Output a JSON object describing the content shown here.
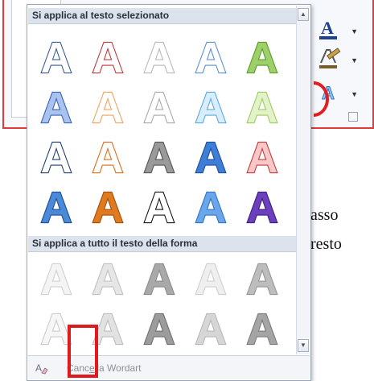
{
  "gallery": {
    "section1_title": "Si applica al testo selezionato",
    "section2_title": "Si applica a tutto il testo della forma",
    "letter": "A",
    "footer_label": "Cancella Wordart",
    "footer_label_prefix": "Canc",
    "footer_label_mnemonic": "e",
    "footer_label_suffix": "lla Wordart",
    "footer_icon": "clear-format-icon"
  },
  "document": {
    "line1": "asso",
    "line2": "resto"
  },
  "ribbon": {
    "tools": [
      {
        "name": "text-fill-icon",
        "letter": "A",
        "accent": "#1f3f8f"
      },
      {
        "name": "text-outline-icon",
        "accent": "#7a5c2c"
      },
      {
        "name": "text-effects-icon",
        "letter": "A",
        "accent": "#2f6fd0"
      }
    ]
  },
  "styles_selected_text": [
    [
      {
        "fill": "#ffffff",
        "stroke": "#3d5b8f"
      },
      {
        "fill": "#ffffff",
        "stroke": "#c0393b"
      },
      {
        "fill": "#ffffff",
        "stroke": "#b8b8b8"
      },
      {
        "fill": "#ffffff",
        "stroke": "#5d8fd3"
      },
      {
        "fill": "#9ed06a",
        "stroke": "#5c9a2a"
      }
    ],
    [
      {
        "fill": "#aac3ee",
        "stroke": "#3a63b8"
      },
      {
        "fill": "#ffffff",
        "stroke": "#f2a25c"
      },
      {
        "fill": "#ffffff",
        "stroke": "#a8a8a8"
      },
      {
        "fill": "#d8eefc",
        "stroke": "#5ea6e0"
      },
      {
        "fill": "#e3f2c8",
        "stroke": "#9ccb62"
      }
    ],
    [
      {
        "fill": "#ffffff",
        "stroke": "#1f3e6e"
      },
      {
        "fill": "#ffffff",
        "stroke": "#e06a15"
      },
      {
        "fill": "#9a9a9a",
        "stroke": "#555555"
      },
      {
        "fill": "#3d7fd6",
        "stroke": "#1e4d9b"
      },
      {
        "fill": "#f8c8c8",
        "stroke": "#c23b3b"
      }
    ],
    [
      {
        "fill": "#4a8ad8",
        "stroke": "#1d4d91"
      },
      {
        "fill": "#e07a1e",
        "stroke": "#a34d0c"
      },
      {
        "fill": "#ffffff",
        "stroke": "#111111"
      },
      {
        "fill": "#6aa7ea",
        "stroke": "#3273c4"
      },
      {
        "fill": "#6b3fbd",
        "stroke": "#3d1e7a"
      }
    ]
  ],
  "styles_whole_shape": [
    [
      {
        "fill": "#f4f4f4",
        "stroke": "#d0d0d0"
      },
      {
        "fill": "#e6e6e6",
        "stroke": "#c0c0c0"
      },
      {
        "fill": "#a9a9a9",
        "stroke": "#8a8a8a"
      },
      {
        "fill": "#efefef",
        "stroke": "#cfcfcf"
      },
      {
        "fill": "#bdbdbd",
        "stroke": "#959595"
      }
    ],
    [
      {
        "fill": "#f6f6f6",
        "stroke": "#cccccc"
      },
      {
        "fill": "#e2e2e2",
        "stroke": "#bdbdbd"
      },
      {
        "fill": "#9c9c9c",
        "stroke": "#707070"
      },
      {
        "fill": "#d6d6d6",
        "stroke": "#b8b8b8"
      },
      {
        "fill": "#a5a5a5",
        "stroke": "#7b7b7b"
      }
    ]
  ]
}
